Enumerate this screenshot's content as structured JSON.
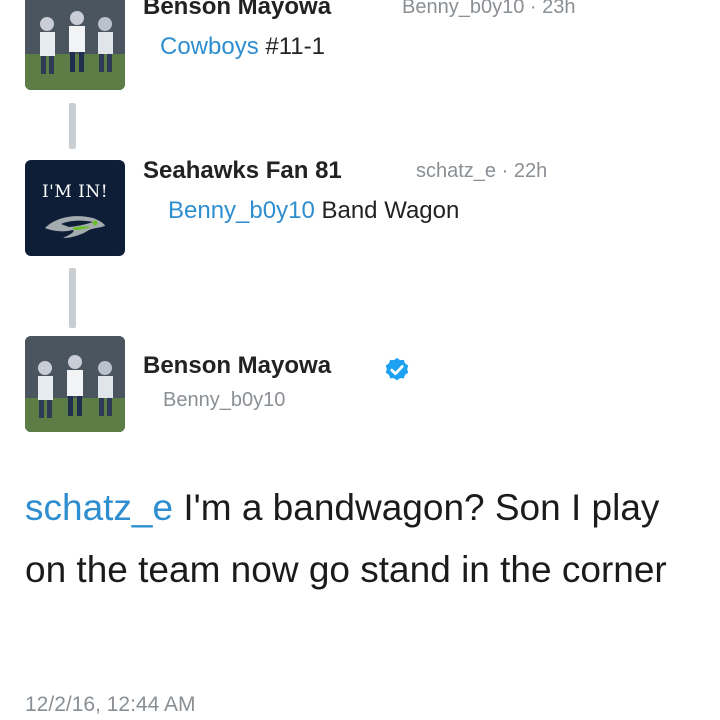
{
  "tweets": [
    {
      "author_name": "Benson Mayowa",
      "handle": "Benny_b0y10",
      "time": "23h",
      "reply_mention": "Cowboys",
      "reply_text": "#11-1"
    },
    {
      "author_name": "Seahawks Fan 81",
      "handle": "schatz_e",
      "time": "22h",
      "avatar_text": "I'M IN!",
      "reply_mention": "Benny_b0y10",
      "reply_text": "Band Wagon"
    }
  ],
  "focused_tweet": {
    "author_name": "Benson Mayowa",
    "handle": "Benny_b0y10",
    "verified": true,
    "mention": "schatz_e",
    "body": "I'm a bandwagon? Son I play on the team now go stand in the corner",
    "timestamp": "12/2/16, 12:44 AM"
  },
  "colors": {
    "mention": "#2f8ed0",
    "verified_badge": "#1da1f2",
    "thread_line": "#c9ced3",
    "seahawks_navy": "#0d1e36",
    "seahawks_green": "#69be28"
  },
  "icons": [
    "verified-badge-icon",
    "seahawks-logo-icon"
  ]
}
